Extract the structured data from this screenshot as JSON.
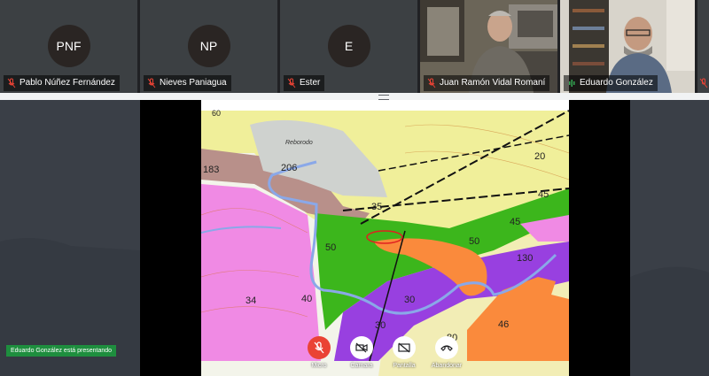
{
  "participants": [
    {
      "initials": "PNF",
      "name": "Pablo Núñez Fernández"
    },
    {
      "initials": "NP",
      "name": "Nieves Paniagua"
    },
    {
      "initials": "E",
      "name": "Ester"
    },
    {
      "name": "Juan Ramón Vidal Romaní"
    },
    {
      "name": "Eduardo González"
    }
  ],
  "presenting_banner": "Eduardo González está presentando",
  "controls": {
    "mic": "Micro",
    "camera": "Cámara",
    "screen": "Pantalla",
    "leave": "Abandonar"
  },
  "map_labels": {
    "l60": "60",
    "l183": "183",
    "l206": "206",
    "l20": "20",
    "l45a": "45",
    "l35": "35",
    "l45b": "45",
    "l50a": "50",
    "l50b": "50",
    "l130": "130",
    "l34": "34",
    "l40": "40",
    "l30a": "30",
    "l30b": "30",
    "l46": "46",
    "l80": "80",
    "reborodo": "Reborodo"
  },
  "colors": {
    "mic_off_red": "#ea4335",
    "banner_green": "#1e8e3e",
    "talking_green": "#34a853"
  }
}
